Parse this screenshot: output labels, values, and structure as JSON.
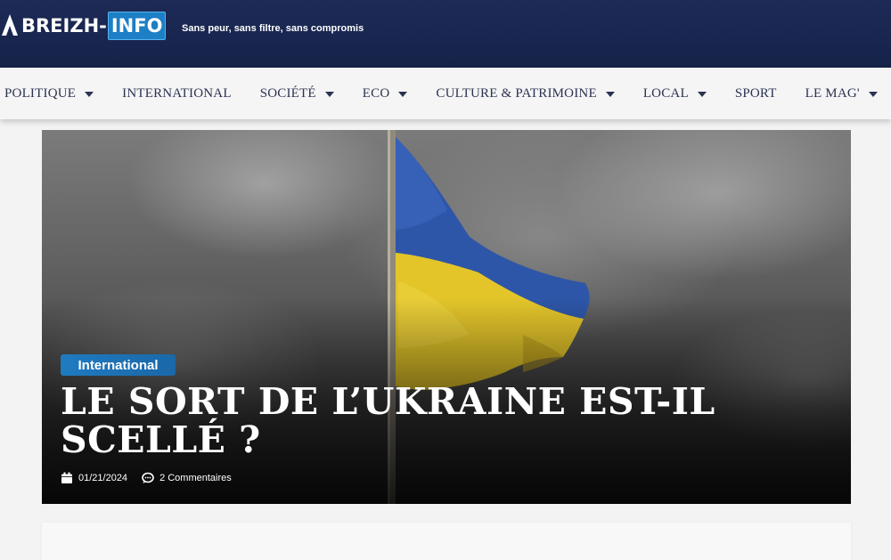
{
  "header": {
    "logo_part1": "BREIZH-",
    "logo_part2": "INFO",
    "tagline": "Sans peur, sans filtre, sans compromis"
  },
  "nav": {
    "items": [
      {
        "label": "POLITIQUE",
        "has_dropdown": true
      },
      {
        "label": "INTERNATIONAL",
        "has_dropdown": false
      },
      {
        "label": "SOCIÉTÉ",
        "has_dropdown": true
      },
      {
        "label": "ECO",
        "has_dropdown": true
      },
      {
        "label": "CULTURE & PATRIMOINE",
        "has_dropdown": true
      },
      {
        "label": "LOCAL",
        "has_dropdown": true
      },
      {
        "label": "SPORT",
        "has_dropdown": false
      },
      {
        "label": "LE MAG'",
        "has_dropdown": true
      }
    ]
  },
  "hero": {
    "category": "International",
    "title": "LE SORT DE L’UKRAINE EST-IL SCELLÉ ?",
    "date": "01/21/2024",
    "comments": "2 Commentaires"
  },
  "colors": {
    "header_bg": "#182650",
    "accent_blue": "#1d7fc6",
    "nav_text": "#2c3350",
    "flag_blue": "#2e56a8",
    "flag_yellow": "#e3c52a"
  },
  "icons": {
    "date": "calendar-icon",
    "comments": "comment-bubble-icon",
    "dropdown": "caret-down-icon"
  }
}
